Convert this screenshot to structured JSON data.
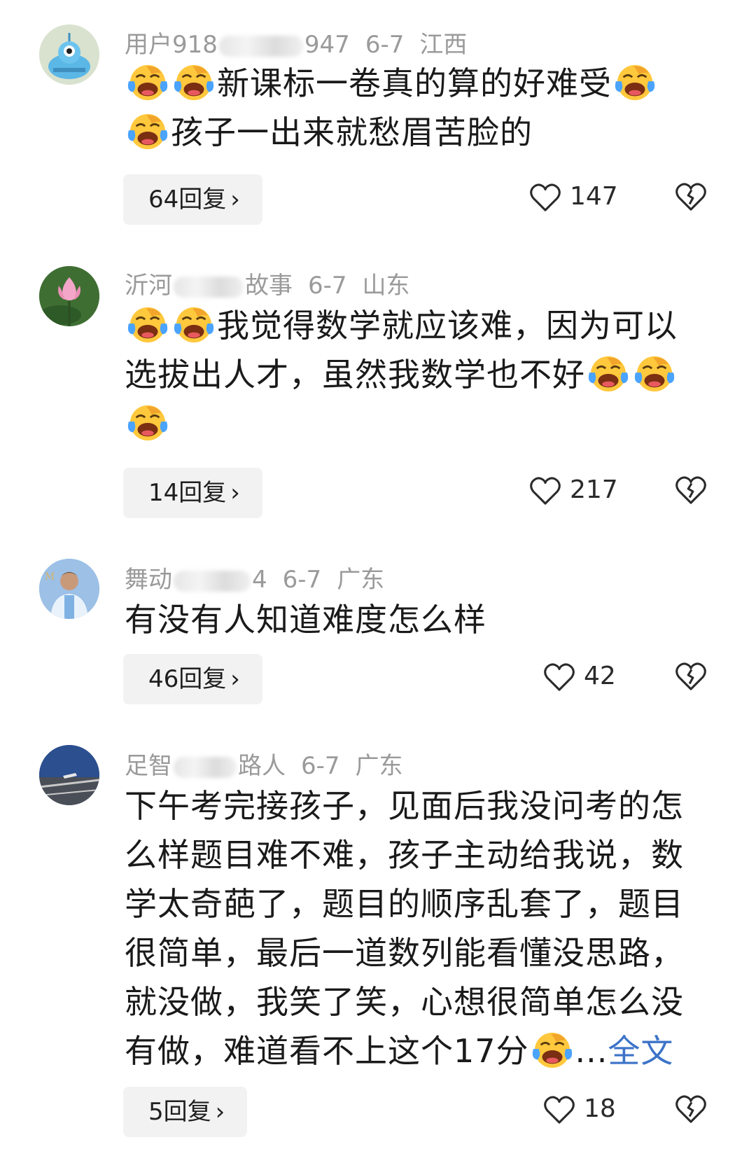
{
  "comments": [
    {
      "user": {
        "prefix": "用户918",
        "suffix": "947"
      },
      "date": "6-7",
      "location": "江西",
      "lines": [
        "新课标一卷真的算的好难受",
        "孩子一出来就愁眉苦脸的"
      ],
      "replies": "64回复",
      "likes": "147"
    },
    {
      "user": {
        "prefix": "沂河",
        "suffix": "故事"
      },
      "date": "6-7",
      "location": "山东",
      "lines": [
        "我觉得数学就应该难，因为可以选拔出人才，虽然我数学也不好"
      ],
      "replies": "14回复",
      "likes": "217"
    },
    {
      "user": {
        "prefix": "舞动",
        "suffix": "4"
      },
      "date": "6-7",
      "location": "广东",
      "lines": [
        "有没有人知道难度怎么样"
      ],
      "replies": "46回复",
      "likes": "42"
    },
    {
      "user": {
        "prefix": "足智",
        "suffix": "路人"
      },
      "date": "6-7",
      "location": "广东",
      "lines": [
        "下午考完接孩子，见面后我没问考的怎么样题目难不难，孩子主动给我说，数学太奇葩了，题目的顺序乱套了，题目很简单，最后一道数列能看懂没思路，就没做，我笑了笑，心想很简单怎么没有做，难道看不上这个17分"
      ],
      "ellipsis": "...",
      "more": "全文",
      "replies": "5回复",
      "likes": "18"
    }
  ],
  "icons": {
    "emoji": "laughing-crying-emoji",
    "like": "heart-outline-icon",
    "dislike": "broken-heart-icon",
    "chevron": "chevron-right-icon"
  },
  "colors": {
    "link": "#3c73c8",
    "meta": "#9a9a9a",
    "button_bg": "#f2f2f2"
  }
}
